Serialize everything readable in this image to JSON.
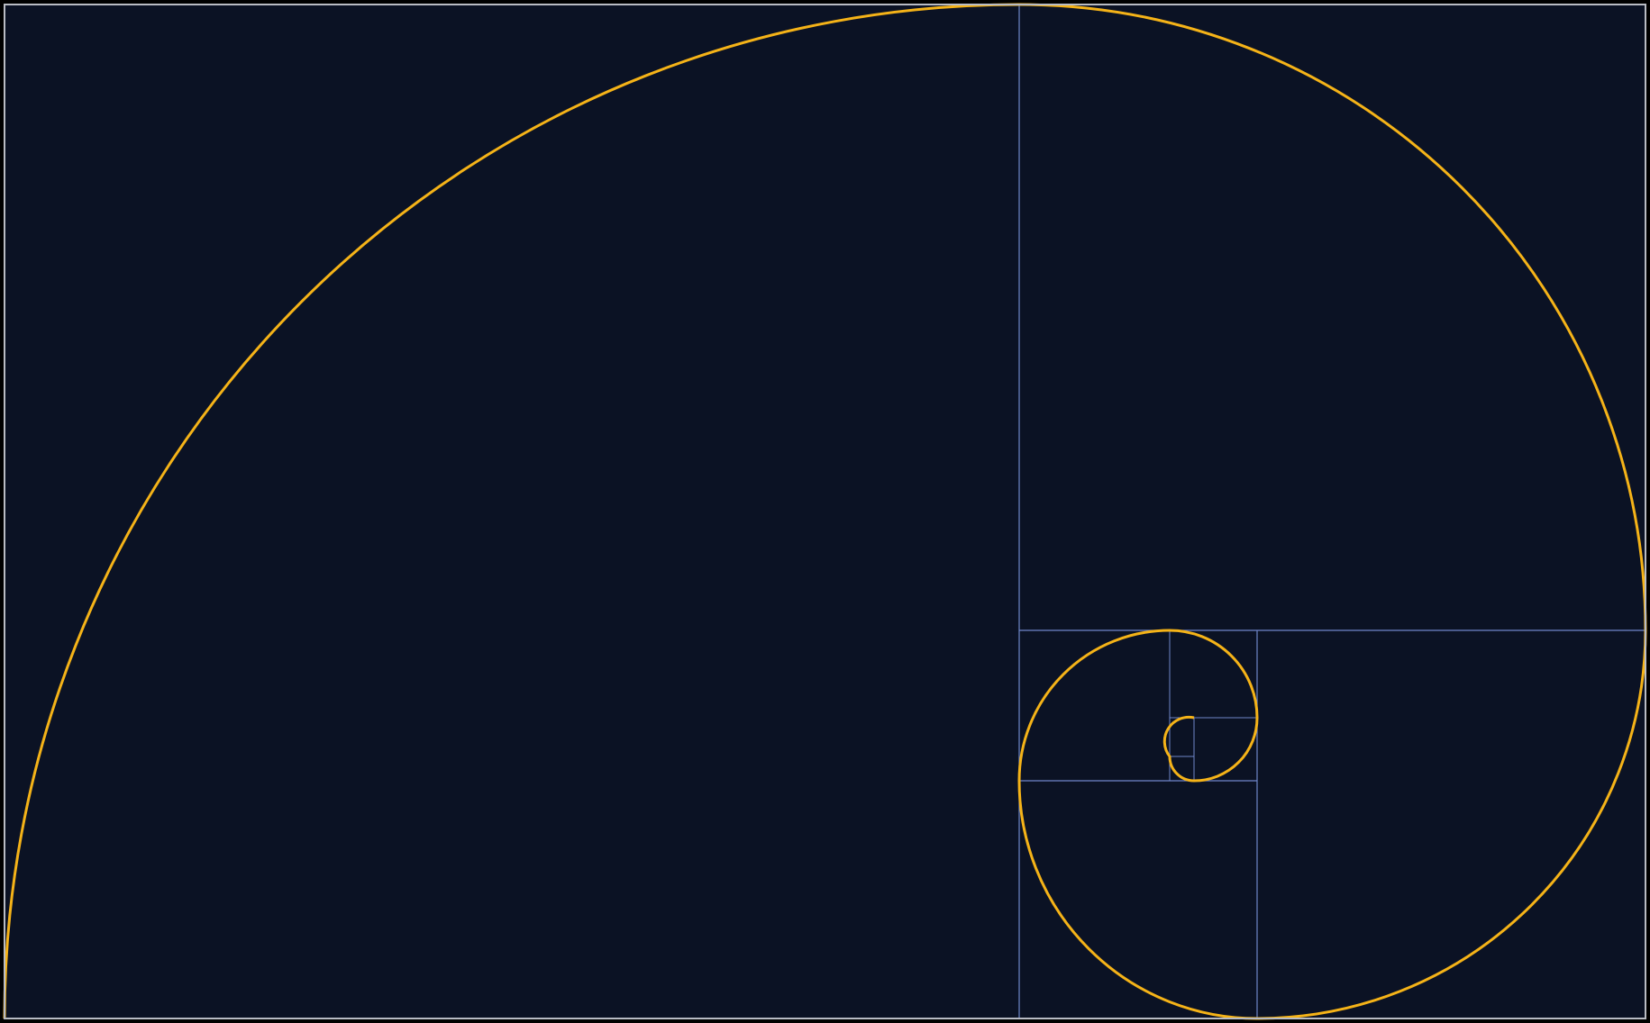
{
  "diagram": {
    "kind": "golden-spiral",
    "colors": {
      "page_background": "#000000",
      "panel_background": "#0b1224",
      "frame": "#b9bcc4",
      "grid": "#6f86c9",
      "spiral": "#f5b318"
    },
    "subdivision_count": 9,
    "rotation_pattern": [
      "left",
      "top",
      "right",
      "bottom"
    ]
  }
}
